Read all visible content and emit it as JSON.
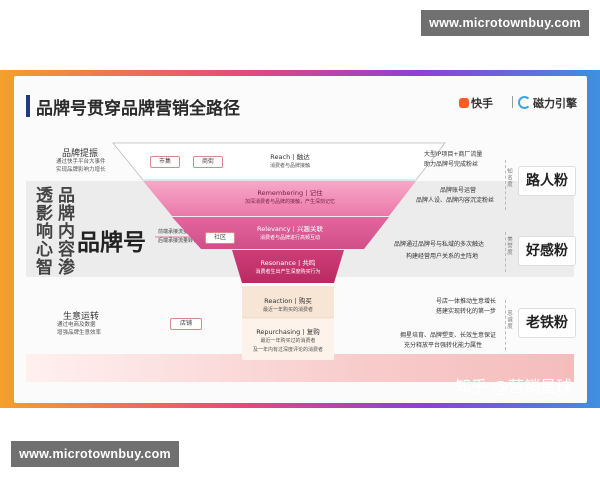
{
  "watermark": {
    "top": "www.microtownbuy.com",
    "bottom": "www.microtownbuy.com"
  },
  "header": {
    "title": "品牌号贯穿品牌营销全路径",
    "logo_kuaishou": "快手",
    "logo_cili": "磁力引擎"
  },
  "left": {
    "brand_mention": {
      "title": "品牌提振",
      "sub1": "通过快手平台大事件",
      "sub2": "实现品牌影响力增长"
    },
    "side_vertical_1": "透影响心智",
    "side_vertical_2": "品牌内容渗",
    "big_brand": "品牌号",
    "ops": {
      "title": "生意运转",
      "sub1": "通过电商及数据",
      "sub2": "增强品牌生意效率"
    },
    "note1": "前端承接流量进入",
    "note2": "后端承接流量转化"
  },
  "tags": {
    "market": "市集",
    "merchant": "商街",
    "community": "社区",
    "store": "店铺"
  },
  "funnel": {
    "layers": [
      {
        "title": "Reach丨触达",
        "sub": "消费者与品牌接触",
        "color": "#ffffff",
        "text": "#333333"
      },
      {
        "title": "Remembering丨记住",
        "sub": "加深消费者与品牌的接触，产生深刻记忆",
        "color": "#f08ab5",
        "text": "#7a1d4a"
      },
      {
        "title": "Relevancy丨兴趣关联",
        "sub": "消费者与品牌进行高频互动",
        "color": "#e0609a",
        "text": "#ffffff"
      },
      {
        "title": "Resonance丨共鸣",
        "sub": "消费者生出产生深度购买行为",
        "color": "#c8366f",
        "text": "#ffffff"
      },
      {
        "title": "Reaction丨购买",
        "sub": "最近一年购买的消费者",
        "color": "#f7e6d6",
        "text": "#333333"
      },
      {
        "title": "Repurchasing丨复购",
        "sub1": "最近一年购买过的消费者",
        "sub2": "及一年内有过深度评论的消费者",
        "color": "#fdf3ea",
        "text": "#333333"
      }
    ]
  },
  "right": {
    "group1": {
      "d1": "大型IP项目+商厂流量",
      "d2": "助力品牌号完成粉丝",
      "d3": "品牌账号运营",
      "d4": "品牌人设、品牌内容沉淀粉丝",
      "vertical": "知名度",
      "pill": "路人粉"
    },
    "group2": {
      "d1": "品牌通过品牌号与私域的多次触达",
      "d2": "构建经营用户关系的主阵地",
      "vertical": "美誉度",
      "pill": "好感粉"
    },
    "group3": {
      "d1": "号店一体推动生意增长",
      "d2": "搭建实现转化的第一步",
      "d3": "拥星培育、品牌塑变、长效生意保证",
      "d4": "充分释放平台强转化能力属性",
      "vertical": "忠诚度",
      "pill": "老铁粉"
    }
  },
  "credit": "知乎 @营销星球",
  "colors": {
    "title_bar": "#1f3d7a",
    "pink_accent": "#e0609a"
  }
}
